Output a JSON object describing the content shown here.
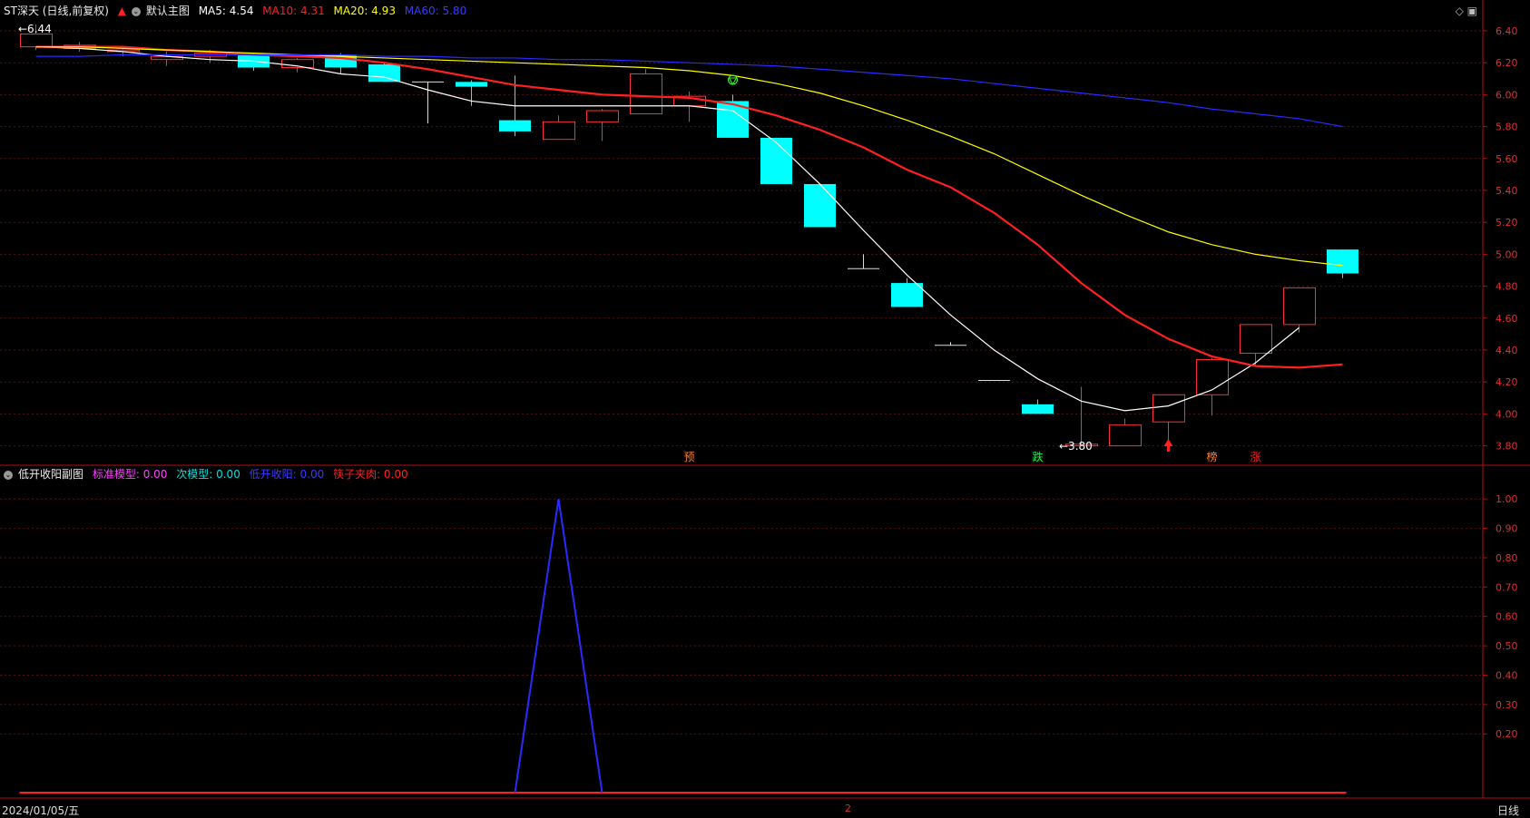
{
  "main_header": {
    "title": "ST深天 (日线,前复权)",
    "arrow": "▲",
    "panel_name": "默认主图",
    "ma": [
      {
        "label": "MA5: 4.54",
        "color": "#ffffff"
      },
      {
        "label": "MA10: 4.31",
        "color": "#ff2020"
      },
      {
        "label": "MA20: 4.93",
        "color": "#ffff00"
      },
      {
        "label": "MA60: 5.80",
        "color": "#2a2aff"
      }
    ]
  },
  "sub_header": {
    "panel_name": "低开收阳副图",
    "items": [
      {
        "label": "标准模型: 0.00",
        "color": "#ff40ff"
      },
      {
        "label": "次模型: 0.00",
        "color": "#00e0e0"
      },
      {
        "label": "低开收阳: 0.00",
        "color": "#2a2aff"
      },
      {
        "label": "筷子夹肉: 0.00",
        "color": "#ff2020"
      }
    ]
  },
  "main_axis": [
    "6.40",
    "6.20",
    "6.00",
    "5.80",
    "5.60",
    "5.40",
    "5.20",
    "5.00",
    "4.80",
    "4.60",
    "4.40",
    "4.20",
    "4.00",
    "3.80"
  ],
  "sub_axis": [
    "1.00",
    "0.90",
    "0.80",
    "0.70",
    "0.60",
    "0.50",
    "0.40",
    "0.30",
    "0.20"
  ],
  "annotations": {
    "high_label": "6.44",
    "low_label": "3.80",
    "marks": [
      {
        "text": "预",
        "color": "#ff8030"
      },
      {
        "text": "跌",
        "color": "#00ff40"
      },
      {
        "text": "榜",
        "color": "#ff8030"
      },
      {
        "text": "涨",
        "color": "#ff2020"
      }
    ]
  },
  "bottom": {
    "date": "2024/01/05/五",
    "mid": "2",
    "period": "日线"
  },
  "chart_data": {
    "type": "candlestick",
    "ylim": [
      3.75,
      6.45
    ],
    "candles": [
      {
        "o": 6.3,
        "c": 6.38,
        "h": 6.44,
        "l": 6.28
      },
      {
        "o": 6.29,
        "c": 6.31,
        "h": 6.33,
        "l": 6.27
      },
      {
        "o": 6.27,
        "c": 6.28,
        "h": 6.3,
        "l": 6.24
      },
      {
        "o": 6.22,
        "c": 6.24,
        "h": 6.27,
        "l": 6.18
      },
      {
        "o": 6.24,
        "c": 6.26,
        "h": 6.28,
        "l": 6.2
      },
      {
        "o": 6.25,
        "c": 6.17,
        "h": 6.26,
        "l": 6.15
      },
      {
        "o": 6.17,
        "c": 6.22,
        "h": 6.23,
        "l": 6.14
      },
      {
        "o": 6.25,
        "c": 6.17,
        "h": 6.26,
        "l": 6.13
      },
      {
        "o": 6.19,
        "c": 6.08,
        "h": 6.2,
        "l": 6.08
      },
      {
        "o": 6.08,
        "c": 6.08,
        "h": 6.08,
        "l": 5.82
      },
      {
        "o": 6.08,
        "c": 6.05,
        "h": 6.09,
        "l": 5.93
      },
      {
        "o": 5.84,
        "c": 5.77,
        "h": 6.12,
        "l": 5.74
      },
      {
        "o": 5.72,
        "c": 5.83,
        "h": 5.87,
        "l": 5.72
      },
      {
        "o": 5.83,
        "c": 5.9,
        "h": 5.91,
        "l": 5.71
      },
      {
        "o": 5.88,
        "c": 6.13,
        "h": 6.16,
        "l": 5.88
      },
      {
        "o": 5.93,
        "c": 5.99,
        "h": 6.02,
        "l": 5.83
      },
      {
        "o": 5.96,
        "c": 5.73,
        "h": 6.0,
        "l": 5.73
      },
      {
        "o": 5.73,
        "c": 5.44,
        "h": 5.73,
        "l": 5.44
      },
      {
        "o": 5.44,
        "c": 5.17,
        "h": 5.44,
        "l": 5.17
      },
      {
        "o": 4.91,
        "c": 4.91,
        "h": 5.0,
        "l": 4.91
      },
      {
        "o": 4.82,
        "c": 4.67,
        "h": 4.85,
        "l": 4.67
      },
      {
        "o": 4.43,
        "c": 4.43,
        "h": 4.45,
        "l": 4.43
      },
      {
        "o": 4.21,
        "c": 4.21,
        "h": 4.21,
        "l": 4.21
      },
      {
        "o": 4.06,
        "c": 4.0,
        "h": 4.09,
        "l": 4.0
      },
      {
        "o": 3.8,
        "c": 3.81,
        "h": 4.17,
        "l": 3.8
      },
      {
        "o": 3.8,
        "c": 3.93,
        "h": 3.97,
        "l": 3.8
      },
      {
        "o": 3.95,
        "c": 4.12,
        "h": 4.12,
        "l": 3.83
      },
      {
        "o": 4.12,
        "c": 4.34,
        "h": 4.35,
        "l": 3.99
      },
      {
        "o": 4.38,
        "c": 4.56,
        "h": 4.56,
        "l": 4.3
      },
      {
        "o": 4.56,
        "c": 4.79,
        "h": 4.79,
        "l": 4.51
      },
      {
        "o": 5.03,
        "c": 4.88,
        "h": 5.03,
        "l": 4.85
      }
    ],
    "series": [
      {
        "name": "MA5",
        "color": "#ffffff",
        "values": [
          6.3,
          6.29,
          6.27,
          6.24,
          6.22,
          6.21,
          6.18,
          6.13,
          6.11,
          6.03,
          5.96,
          5.93,
          5.93,
          5.93,
          5.93,
          5.93,
          5.9,
          5.7,
          5.44,
          5.15,
          4.87,
          4.62,
          4.4,
          4.22,
          4.08,
          4.02,
          4.05,
          4.15,
          4.32,
          4.54
        ]
      },
      {
        "name": "MA10",
        "color": "#ff2020",
        "values": [
          6.3,
          6.3,
          6.3,
          6.28,
          6.27,
          6.25,
          6.24,
          6.23,
          6.2,
          6.16,
          6.11,
          6.06,
          6.03,
          6.0,
          5.99,
          5.98,
          5.94,
          5.87,
          5.78,
          5.67,
          5.53,
          5.42,
          5.26,
          5.06,
          4.82,
          4.62,
          4.47,
          4.36,
          4.3,
          4.29,
          4.31
        ]
      },
      {
        "name": "MA20",
        "color": "#ffff00",
        "values": [
          6.3,
          6.3,
          6.29,
          6.28,
          6.27,
          6.26,
          6.25,
          6.24,
          6.23,
          6.22,
          6.21,
          6.2,
          6.19,
          6.18,
          6.17,
          6.15,
          6.12,
          6.07,
          6.01,
          5.93,
          5.84,
          5.74,
          5.63,
          5.5,
          5.37,
          5.25,
          5.14,
          5.06,
          5.0,
          4.96,
          4.93
        ]
      },
      {
        "name": "MA60",
        "color": "#2a2aff",
        "values": [
          6.24,
          6.24,
          6.25,
          6.25,
          6.25,
          6.25,
          6.25,
          6.25,
          6.24,
          6.24,
          6.23,
          6.23,
          6.22,
          6.22,
          6.21,
          6.2,
          6.19,
          6.18,
          6.16,
          6.14,
          6.12,
          6.1,
          6.07,
          6.04,
          6.01,
          5.98,
          5.95,
          5.91,
          5.88,
          5.85,
          5.8
        ]
      }
    ],
    "sub_series": {
      "name": "低开收阳",
      "color": "#2a2aff",
      "ylim": [
        0,
        1.05
      ],
      "values": [
        0,
        0,
        0,
        0,
        0,
        0,
        0,
        0,
        0,
        0,
        0,
        0,
        1,
        0,
        0,
        0,
        0,
        0,
        0,
        0,
        0,
        0,
        0,
        0,
        0,
        0,
        0,
        0,
        0,
        0,
        0
      ]
    }
  }
}
